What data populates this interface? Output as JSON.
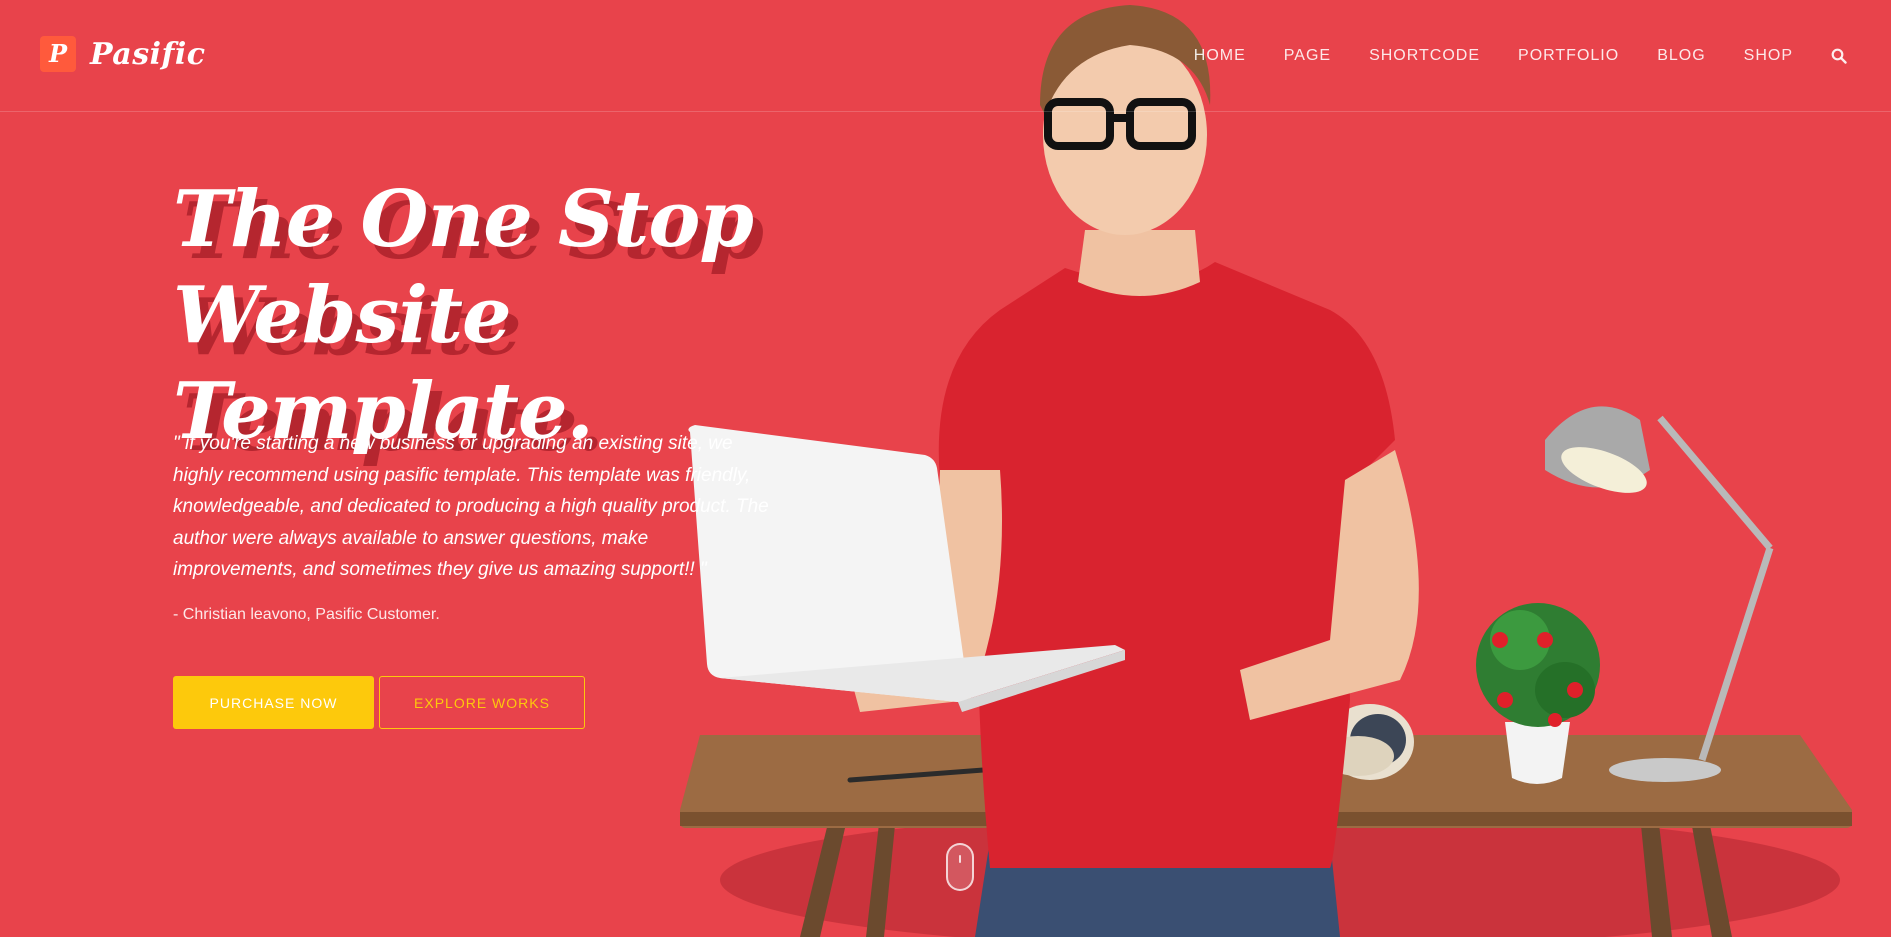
{
  "header": {
    "logo_letter": "P",
    "logo_text": "Pasific",
    "nav": [
      {
        "label": "HOME"
      },
      {
        "label": "PAGE"
      },
      {
        "label": "SHORTCODE"
      },
      {
        "label": "PORTFOLIO"
      },
      {
        "label": "BLOG"
      },
      {
        "label": "SHOP"
      }
    ],
    "search_icon": "search-icon"
  },
  "hero": {
    "headline_line1": "The One Stop",
    "headline_line2": "Website Template.",
    "quote": "\" if you're starting a new business or upgrading an existing site, we highly recommend using pasific template. This template was friendly, knowledgeable, and dedicated to producing a high quality product. The author were always available to answer questions, make improvements, and sometimes they give us amazing support!! \"",
    "attribution": "- Christian leavono, Pasific Customer.",
    "purchase_label": "PURCHASE NOW",
    "explore_label": "EXPLORE WORKS"
  },
  "colors": {
    "background": "#e8434b",
    "accent_yellow": "#fdc90c",
    "logo_orange": "#ff5a3c",
    "headline_shadow": "#b5262f"
  }
}
